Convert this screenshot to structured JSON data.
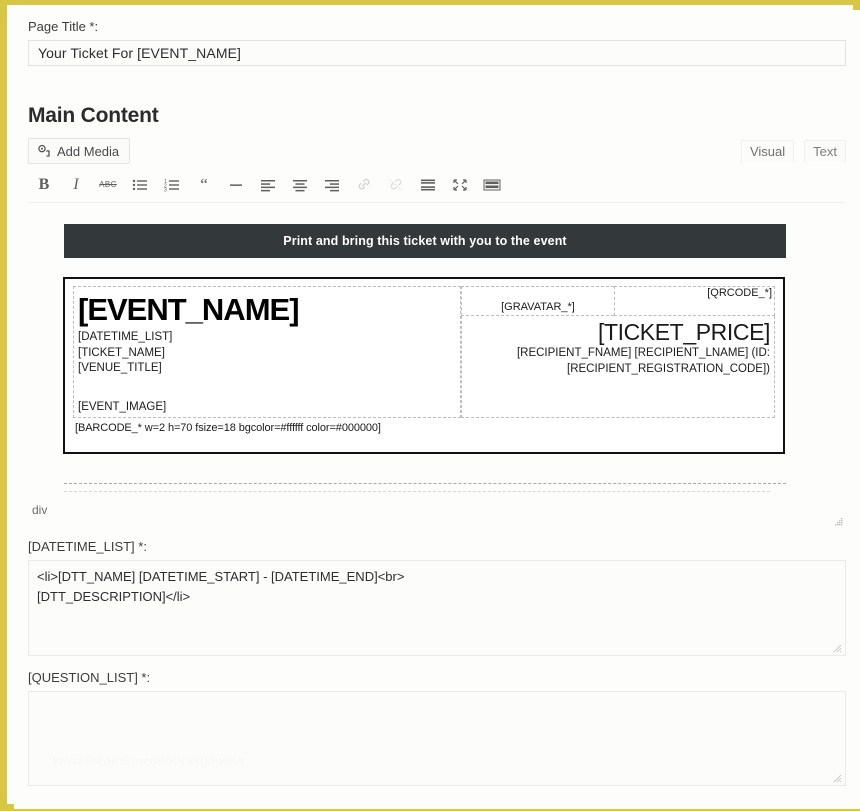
{
  "theme": {
    "frame_color": "#d8c745",
    "banner_bg": "#33383a",
    "banner_text_color": "#ffffff",
    "page_bg": "#fdfdfb"
  },
  "page_title_field": {
    "label": "Page Title *:",
    "value": "Your Ticket For  [EVENT_NAME]"
  },
  "main_content": {
    "heading": "Main Content",
    "add_media_label": "Add Media",
    "tabs": [
      {
        "label": "Visual",
        "active": true
      },
      {
        "label": "Text",
        "active": false
      }
    ],
    "toolbar": [
      {
        "name": "bold-icon",
        "glyph": "B",
        "disabled": false
      },
      {
        "name": "italic-icon",
        "glyph": "I",
        "disabled": false
      },
      {
        "name": "strikethrough-icon",
        "glyph": "ABC",
        "disabled": false
      },
      {
        "name": "bulleted-list-icon",
        "glyph": "",
        "disabled": false
      },
      {
        "name": "numbered-list-icon",
        "glyph": "",
        "disabled": false
      },
      {
        "name": "blockquote-icon",
        "glyph": "“",
        "disabled": false
      },
      {
        "name": "horizontal-rule-icon",
        "glyph": "—",
        "disabled": false
      },
      {
        "name": "align-left-icon",
        "glyph": "",
        "disabled": false
      },
      {
        "name": "align-center-icon",
        "glyph": "",
        "disabled": false
      },
      {
        "name": "align-right-icon",
        "glyph": "",
        "disabled": false
      },
      {
        "name": "insert-link-icon",
        "glyph": "",
        "disabled": true
      },
      {
        "name": "remove-link-icon",
        "glyph": "",
        "disabled": true
      },
      {
        "name": "insert-read-more-icon",
        "glyph": "",
        "disabled": false
      },
      {
        "name": "fullscreen-icon",
        "glyph": "",
        "disabled": false
      },
      {
        "name": "toolbar-toggle-icon",
        "glyph": "",
        "disabled": false
      }
    ]
  },
  "ticket": {
    "banner_text": "Print and bring this ticket with you to the event",
    "event_name": "[EVENT_NAME]",
    "meta_lines": [
      "[DATETIME_LIST]",
      "[TICKET_NAME]",
      "[VENUE_TITLE]"
    ],
    "event_image": "[EVENT_IMAGE]",
    "barcode": "[BARCODE_* w=2 h=70 fsize=18 bgcolor=#ffffff color=#000000]",
    "gravatar": "[GRAVATAR_*]",
    "qrcode": "[QRCODE_*]",
    "ticket_price": "[TICKET_PRICE]",
    "recipient_line_1": "[RECIPIENT_FNAME] [RECIPIENT_LNAME] (ID:",
    "recipient_line_2": "[RECIPIENT_REGISTRATION_CODE])"
  },
  "path_bar": {
    "element": "div"
  },
  "datetime_list_field": {
    "label": "[DATETIME_LIST] *:",
    "line_1": "<li>[DTT_NAME] [DATETIME_START] - [DATETIME_END]<br>",
    "line_2": "[DTT_DESCRIPTION]</li>"
  },
  "question_list_field": {
    "label": "[QUESTION_LIST] *:",
    "value": "",
    "watermark": "www.thedesigncouncil.org/ideas"
  }
}
